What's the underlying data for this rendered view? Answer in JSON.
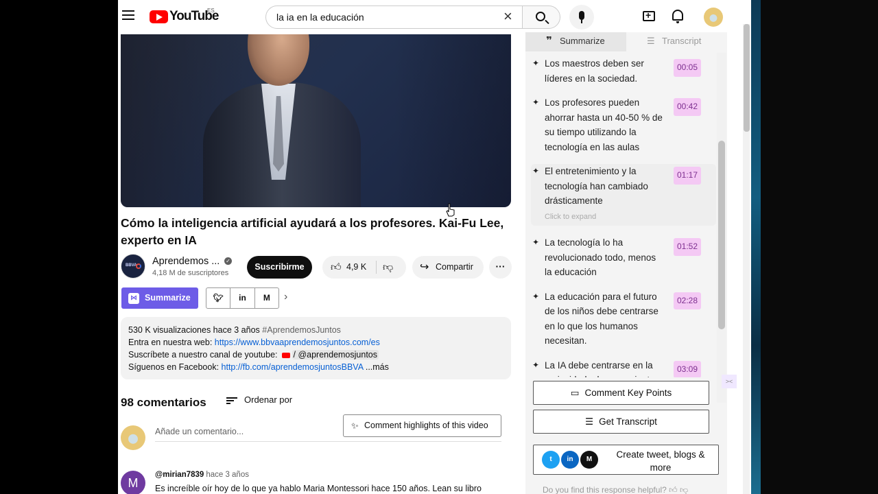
{
  "header": {
    "logo_text": "YouTube",
    "country_code": "ES",
    "search_value": "la ia en la educación"
  },
  "video": {
    "title": "Cómo la inteligencia artificial ayudará a los profesores. Kai-Fu Lee, experto en IA",
    "channel_name": "Aprendemos ...",
    "subscribers": "4,18 M de suscriptores",
    "subscribe_label": "Suscribirme",
    "likes": "4,9 K",
    "share_label": "Compartir",
    "summarize_label": "Summarize"
  },
  "description": {
    "meta": "530 K visualizaciones  hace 3 años",
    "hashtag": "#AprendemosJuntos",
    "line1_prefix": "Entra en nuestra web: ",
    "line1_link": "https://www.bbvaaprendemosjuntos.com/es",
    "line2_prefix": "Suscríbete a nuestro canal de youtube:",
    "line2_handle": "/ @aprendemosjuntos",
    "line3_prefix": "Síguenos en Facebook: ",
    "line3_link": "http://fb.com/aprendemosjuntosBBVA",
    "more": "...más"
  },
  "comments": {
    "count_label": "98 comentarios",
    "sort_label": "Ordenar por",
    "add_placeholder": "Añade un comentario...",
    "highlights_label": "Comment highlights of this video",
    "first": {
      "avatar_letter": "M",
      "author": "@mirian7839",
      "time": "hace 3 años",
      "text": "Es increíble oír hoy de lo que ya hablo Maria Montessori hace 150 años. Lean su libro"
    }
  },
  "panel": {
    "tab_summarize": "Summarize",
    "tab_transcript": "Transcript",
    "items": [
      {
        "text": "Los maestros deben ser líderes en la sociedad.",
        "ts": "00:05"
      },
      {
        "text": "Los profesores pueden ahorrar hasta un 40-50 % de su tiempo utilizando la tecnología en las aulas",
        "ts": "00:42"
      },
      {
        "text": "El entretenimiento y la tecnología han cambiado drásticamente",
        "ts": "01:17",
        "expand": "Click to expand"
      },
      {
        "text": "La tecnología lo ha revolucionado todo, menos la educación",
        "ts": "01:52"
      },
      {
        "text": "La educación para el futuro de los niños debe centrarse en lo que los humanos necesitan.",
        "ts": "02:28"
      },
      {
        "text": "La IA debe centrarse en la curiosidad, el pensamiento",
        "ts": "03:09"
      }
    ],
    "btn_key_points": "Comment Key Points",
    "btn_transcript": "Get Transcript",
    "btn_tweet": "Create tweet, blogs & more",
    "helpful": "Do you find this response helpful?"
  },
  "icons": {
    "menu": "hamburger-icon",
    "search": "search-icon",
    "mic": "mic-icon",
    "create": "create-video-icon",
    "bell": "bell-icon"
  }
}
